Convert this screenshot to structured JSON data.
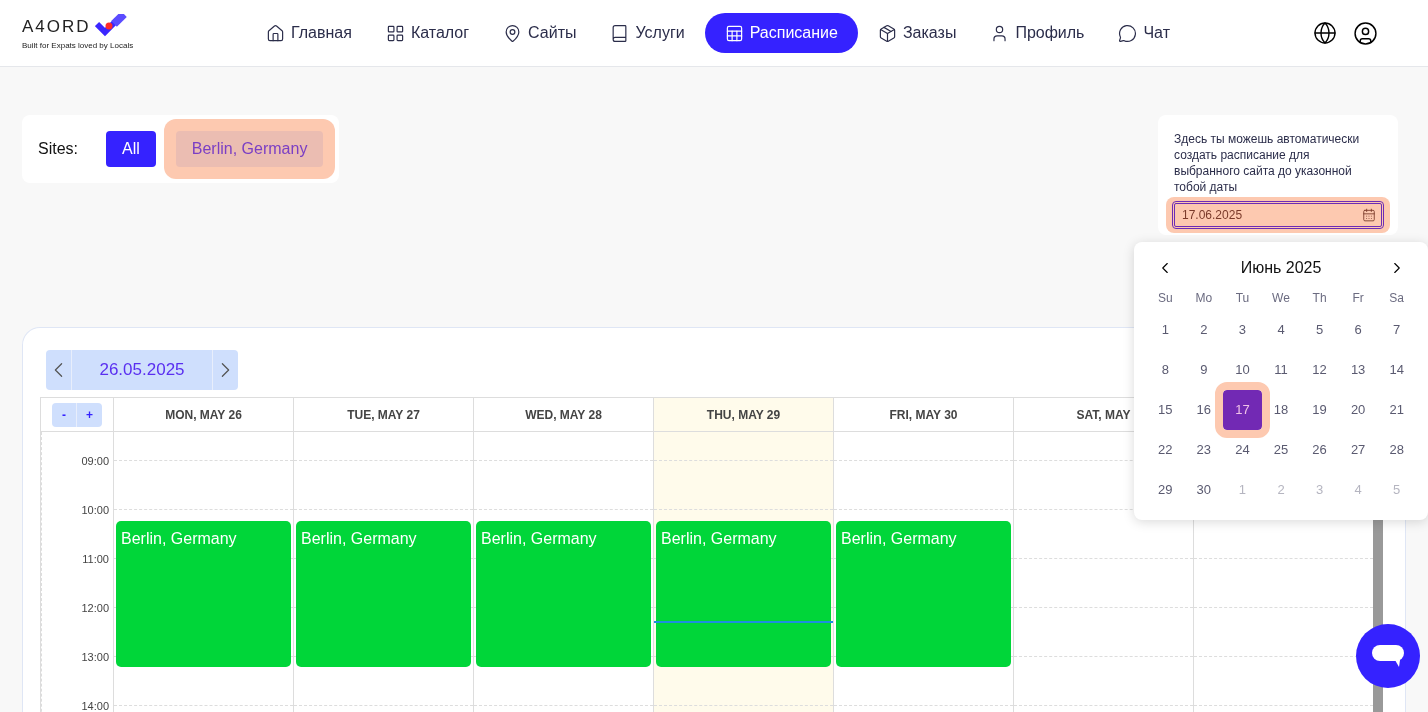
{
  "logo": {
    "wordmark": "A4ORD",
    "tagline": "Built for Expats loved by Locals"
  },
  "nav": [
    {
      "label": "Главная",
      "selected": false
    },
    {
      "label": "Каталог",
      "selected": false
    },
    {
      "label": "Сайты",
      "selected": false
    },
    {
      "label": "Услуги",
      "selected": false
    },
    {
      "label": "Расписание",
      "selected": true
    },
    {
      "label": "Заказы",
      "selected": false
    },
    {
      "label": "Профиль",
      "selected": false
    },
    {
      "label": "Чат",
      "selected": false
    }
  ],
  "sites": {
    "label": "Sites:",
    "options": [
      {
        "label": "All",
        "selected": true,
        "highlighted": false
      },
      {
        "label": "Berlin, Germany",
        "selected": false,
        "highlighted": true
      }
    ]
  },
  "auto_schedule": {
    "description": "Здесь ты можешь автоматически создать расписание для выбранного сайта до указонной тобой даты",
    "date_value": "17.06.2025",
    "highlighted": true
  },
  "date_picker": {
    "month": "Июнь 2025",
    "weekdays": [
      "Su",
      "Mo",
      "Tu",
      "We",
      "Th",
      "Fr",
      "Sa"
    ],
    "weeks": [
      [
        {
          "day": "1",
          "outside": false,
          "selected": false
        },
        {
          "day": "2",
          "outside": false,
          "selected": false
        },
        {
          "day": "3",
          "outside": false,
          "selected": false
        },
        {
          "day": "4",
          "outside": false,
          "selected": false
        },
        {
          "day": "5",
          "outside": false,
          "selected": false
        },
        {
          "day": "6",
          "outside": false,
          "selected": false
        },
        {
          "day": "7",
          "outside": false,
          "selected": false
        }
      ],
      [
        {
          "day": "8",
          "outside": false,
          "selected": false
        },
        {
          "day": "9",
          "outside": false,
          "selected": false
        },
        {
          "day": "10",
          "outside": false,
          "selected": false
        },
        {
          "day": "11",
          "outside": false,
          "selected": false
        },
        {
          "day": "12",
          "outside": false,
          "selected": false
        },
        {
          "day": "13",
          "outside": false,
          "selected": false
        },
        {
          "day": "14",
          "outside": false,
          "selected": false
        }
      ],
      [
        {
          "day": "15",
          "outside": false,
          "selected": false
        },
        {
          "day": "16",
          "outside": false,
          "selected": false
        },
        {
          "day": "17",
          "outside": false,
          "selected": true
        },
        {
          "day": "18",
          "outside": false,
          "selected": false
        },
        {
          "day": "19",
          "outside": false,
          "selected": false
        },
        {
          "day": "20",
          "outside": false,
          "selected": false
        },
        {
          "day": "21",
          "outside": false,
          "selected": false
        }
      ],
      [
        {
          "day": "22",
          "outside": false,
          "selected": false
        },
        {
          "day": "23",
          "outside": false,
          "selected": false
        },
        {
          "day": "24",
          "outside": false,
          "selected": false
        },
        {
          "day": "25",
          "outside": false,
          "selected": false
        },
        {
          "day": "26",
          "outside": false,
          "selected": false
        },
        {
          "day": "27",
          "outside": false,
          "selected": false
        },
        {
          "day": "28",
          "outside": false,
          "selected": false
        }
      ],
      [
        {
          "day": "29",
          "outside": false,
          "selected": false
        },
        {
          "day": "30",
          "outside": false,
          "selected": false
        },
        {
          "day": "1",
          "outside": true,
          "selected": false
        },
        {
          "day": "2",
          "outside": true,
          "selected": false
        },
        {
          "day": "3",
          "outside": true,
          "selected": false
        },
        {
          "day": "4",
          "outside": true,
          "selected": false
        },
        {
          "day": "5",
          "outside": true,
          "selected": false
        }
      ]
    ]
  },
  "schedule": {
    "week_start": "26.05.2025",
    "zoom_out": "-",
    "zoom_in": "+",
    "days": [
      {
        "label": "MON, MAY 26",
        "today": false,
        "events": [
          "Berlin, Germany"
        ]
      },
      {
        "label": "TUE, MAY 27",
        "today": false,
        "events": [
          "Berlin, Germany"
        ]
      },
      {
        "label": "WED, MAY 28",
        "today": false,
        "events": [
          "Berlin, Germany"
        ]
      },
      {
        "label": "THU, MAY 29",
        "today": true,
        "events": [
          "Berlin, Germany"
        ]
      },
      {
        "label": "FRI, MAY 30",
        "today": false,
        "events": [
          "Berlin, Germany"
        ]
      },
      {
        "label": "SAT, MAY",
        "today": false
      },
      {
        "today": false
      }
    ],
    "hours": [
      "09:00",
      "10:00",
      "11:00",
      "12:00",
      "13:00",
      "14:00"
    ]
  }
}
